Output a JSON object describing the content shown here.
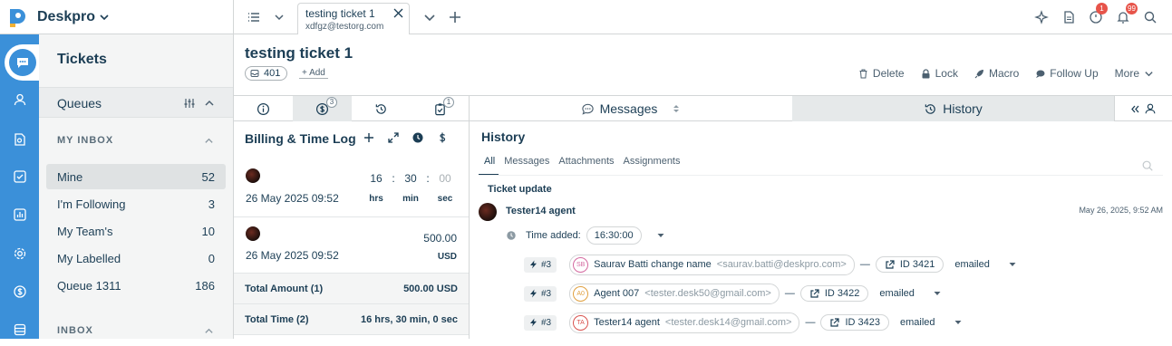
{
  "app": {
    "brand": "Deskpro"
  },
  "tabbar": {
    "ticket_tab_title": "testing ticket 1",
    "ticket_tab_subtitle": "xdfgz@testorg.com"
  },
  "top_badges": {
    "chat": "1",
    "notifications": "99"
  },
  "sidebar": {
    "title": "Tickets",
    "queues_label": "Queues",
    "my_inbox_label": "MY INBOX",
    "items": [
      {
        "label": "Mine",
        "count": "52"
      },
      {
        "label": "I'm Following",
        "count": "3"
      },
      {
        "label": "My Team's",
        "count": "10"
      },
      {
        "label": "My Labelled",
        "count": "0"
      },
      {
        "label": "Queue 1311",
        "count": "186"
      }
    ],
    "inbox_label": "INBOX"
  },
  "ticket": {
    "title": "testing ticket 1",
    "id": "401",
    "add_label": "+ Add",
    "actions": [
      "Delete",
      "Lock",
      "Macro",
      "Follow Up",
      "More"
    ]
  },
  "left_tabs": {
    "billing_count": "3",
    "tasks_count": "1"
  },
  "billing": {
    "title": "Billing & Time Log",
    "entries": [
      {
        "date": "26 May 2025 09:52",
        "hrs": "16",
        "min": "30",
        "sec": "00",
        "hrs_label": "hrs",
        "min_label": "min",
        "sec_label": "sec"
      },
      {
        "date": "26 May 2025 09:52",
        "amount": "500.00",
        "currency": "USD"
      }
    ],
    "total_amount_label": "Total Amount (1)",
    "total_amount_value": "500.00 USD",
    "total_time_label": "Total Time (2)",
    "total_time_value": "16 hrs, 30 min, 0 sec"
  },
  "right_tabs": {
    "messages": "Messages",
    "history": "History"
  },
  "history": {
    "title": "History",
    "filters": [
      "All",
      "Messages",
      "Attachments",
      "Assignments"
    ],
    "update_label": "Ticket update",
    "agent_name": "Tester14 agent",
    "timestamp": "May 26, 2025, 9:52 AM",
    "time_added_label": "Time added:",
    "time_added_value": "16:30:00",
    "email_rows": [
      {
        "hash": "#3",
        "initials": "SB",
        "name": "Saurav Batti change name",
        "email": "<saurav.batti@deskpro.com>",
        "ticket": "ID 3421",
        "status": "emailed",
        "color": "#d46aa0"
      },
      {
        "hash": "#3",
        "initials": "A0",
        "name": "Agent 007",
        "email": "<tester.desk50@gmail.com>",
        "ticket": "ID 3422",
        "status": "emailed",
        "color": "#e0a040"
      },
      {
        "hash": "#3",
        "initials": "TA",
        "name": "Tester14 agent",
        "email": "<tester.desk14@gmail.com>",
        "ticket": "ID 3423",
        "status": "emailed",
        "color": "#d9534f"
      }
    ]
  },
  "colors": {
    "rail": "#3b90d9",
    "text": "#1c3e55",
    "badge": "#e7544a"
  }
}
